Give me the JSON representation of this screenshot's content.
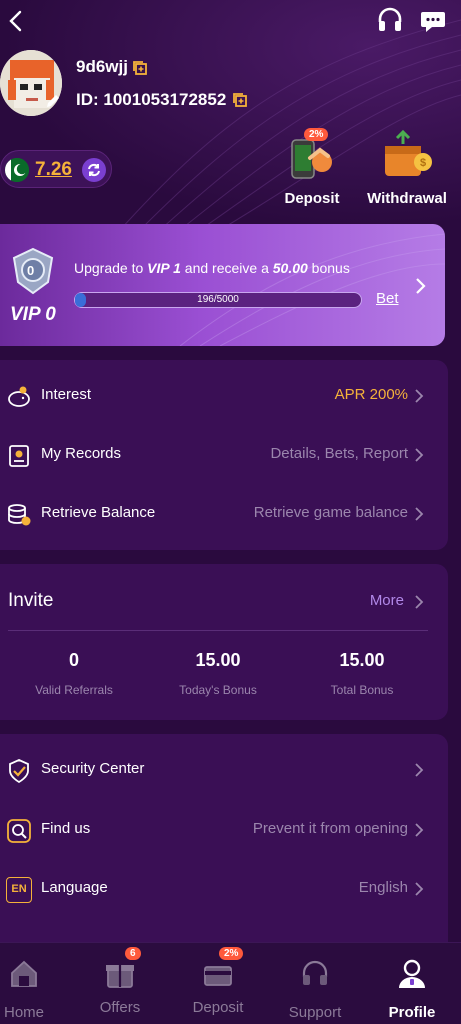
{
  "user": {
    "username": "9d6wjj",
    "id_label": "ID: 1001053172852",
    "balance": "7.26"
  },
  "actions": {
    "deposit_label": "Deposit",
    "deposit_badge": "2%",
    "withdrawal_label": "Withdrawal"
  },
  "vip": {
    "level": "VIP 0",
    "badge_number": "0",
    "upgrade_prefix": "Upgrade to ",
    "upgrade_target": "VIP 1",
    "upgrade_middle": " and receive a ",
    "upgrade_amount": "50.00",
    "upgrade_suffix": " bonus",
    "progress_text": "196/5000",
    "progress_fraction": 0.0392,
    "bet_label": "Bet"
  },
  "menu1": [
    {
      "label": "Interest",
      "value": "APR 200%",
      "value_color": "#f5b23a"
    },
    {
      "label": "My Records",
      "value": "Details, Bets, Report"
    },
    {
      "label": "Retrieve Balance",
      "value": "Retrieve game balance"
    }
  ],
  "invite": {
    "title": "Invite",
    "more_label": "More",
    "stats": [
      {
        "value": "0",
        "label": "Valid Referrals"
      },
      {
        "value": "15.00",
        "label": "Today's Bonus"
      },
      {
        "value": "15.00",
        "label": "Total Bonus"
      }
    ]
  },
  "menu2": [
    {
      "label": "Security Center",
      "value": ""
    },
    {
      "label": "Find us",
      "value": "Prevent it from opening"
    },
    {
      "label": "Language",
      "value": "English",
      "icon_text": "EN"
    }
  ],
  "nav": [
    {
      "label": "Home"
    },
    {
      "label": "Offers",
      "badge": "6"
    },
    {
      "label": "Deposit",
      "badge": "2%"
    },
    {
      "label": "Support"
    },
    {
      "label": "Profile"
    }
  ],
  "colors": {
    "accent_gold": "#f5b23a",
    "background": "#2a0a3e",
    "panel": "#3a0f55",
    "muted_text": "#9b86ad",
    "link_purple": "#b188e8"
  }
}
